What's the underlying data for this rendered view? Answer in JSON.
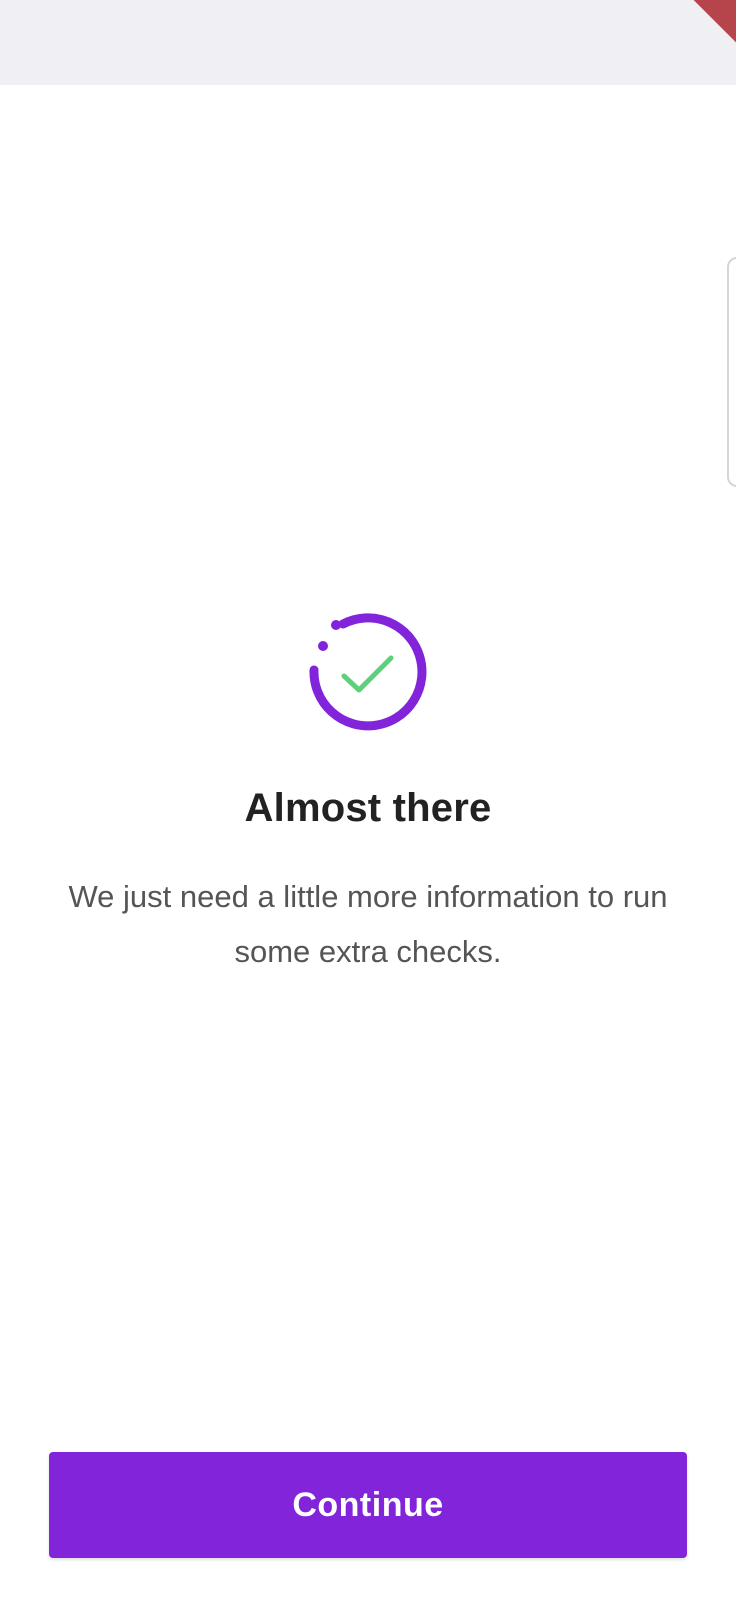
{
  "colors": {
    "accent": "#8224d9",
    "check": "#5cd07a",
    "top_bar": "#efeff4",
    "title": "#222222",
    "body_text": "#555555"
  },
  "header": {
    "icons": [
      "corner-ribbon"
    ]
  },
  "hero": {
    "icon": "progress-check-icon",
    "title": "Almost there",
    "description": "We just need a little more information to run some extra checks."
  },
  "footer": {
    "continue_label": "Continue"
  }
}
